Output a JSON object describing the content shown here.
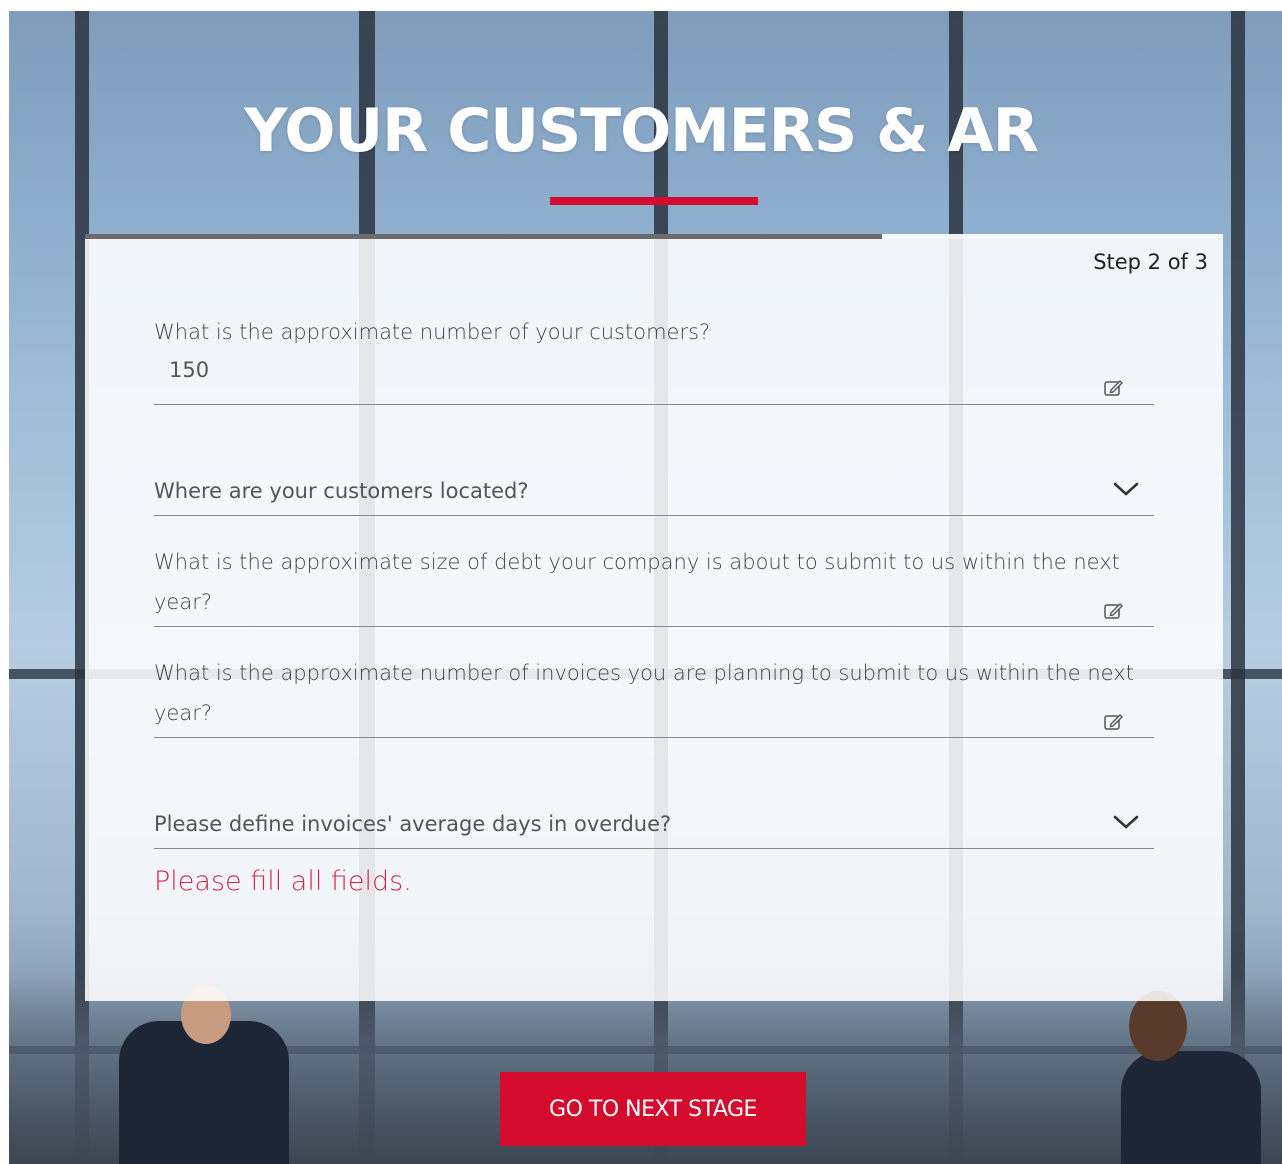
{
  "header": {
    "title": "YOUR CUSTOMERS & AR"
  },
  "progress": {
    "fraction": 0.7,
    "step_label": "Step 2 of 3"
  },
  "form": {
    "customers_count": {
      "label": "What is the approximate number of your customers?",
      "value": "150",
      "icon": "edit-icon"
    },
    "customers_location": {
      "placeholder": "Where are your customers located?",
      "icon": "chevron-down-icon"
    },
    "debt_size": {
      "label_line1": "What is the approximate size of debt your company is about to submit to us within the next",
      "label_line2": "year?",
      "icon": "edit-icon"
    },
    "invoices_count": {
      "label_line1": "What is the approximate number of invoices you are planning to submit to us within the next",
      "label_line2": "year?",
      "icon": "edit-icon"
    },
    "overdue_days": {
      "placeholder": "Please define invoices' average days in overdue?",
      "icon": "chevron-down-icon"
    },
    "error_message": "Please fill all fields."
  },
  "actions": {
    "next_label": "GO TO NEXT STAGE"
  },
  "colors": {
    "accent": "#d50b2d",
    "error": "#d4264a",
    "progress": "#6b6b6b"
  }
}
